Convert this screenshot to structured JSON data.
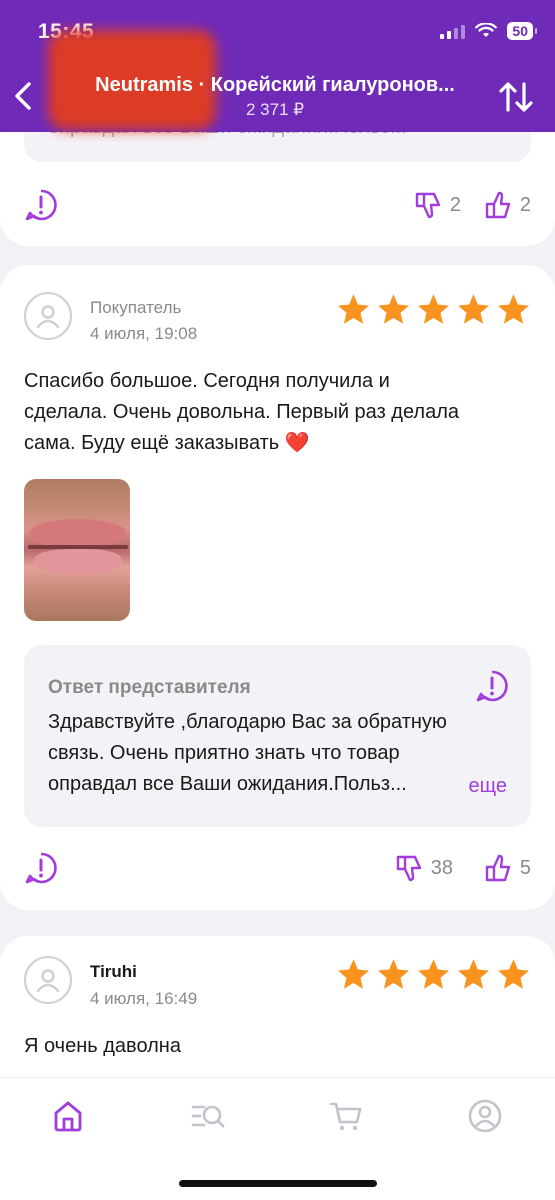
{
  "status_bar": {
    "time": "15:45",
    "battery": "50"
  },
  "header": {
    "title": "Neutramis · Корейский гиалуронов...",
    "price": "2 371 ₽"
  },
  "colors": {
    "accent": "#a03ddb",
    "header_bg": "#6f2ab8",
    "star": "#f7931e"
  },
  "previous_review": {
    "reply_tail_text": "оправдал все Ваши ожидания.Польз...",
    "dislikes": "2",
    "likes": "2"
  },
  "review": {
    "author": "Покупатель",
    "date": "4 июля, 19:08",
    "rating": 5,
    "text_lines": [
      "Спасибо большое. Сегодня получила и",
      "сделала. Очень довольна. Первый раз делала",
      "сама. Буду ещё заказывать"
    ],
    "heart": "❤️",
    "reply": {
      "title": "Ответ представителя",
      "lines": [
        "Здравствуйте ,благодарю Вас за обратную",
        "связь. Очень приятно знать что товар",
        "оправдал все Ваши ожидания.Польз..."
      ],
      "more": "еще"
    },
    "dislikes": "38",
    "likes": "5"
  },
  "next_review": {
    "author": "Tiruhi",
    "date": "4 июля, 16:49",
    "rating": 5,
    "text": "Я очень даволна"
  },
  "bottom_nav": [
    "home-icon",
    "catalog-search-icon",
    "cart-icon",
    "profile-icon"
  ]
}
